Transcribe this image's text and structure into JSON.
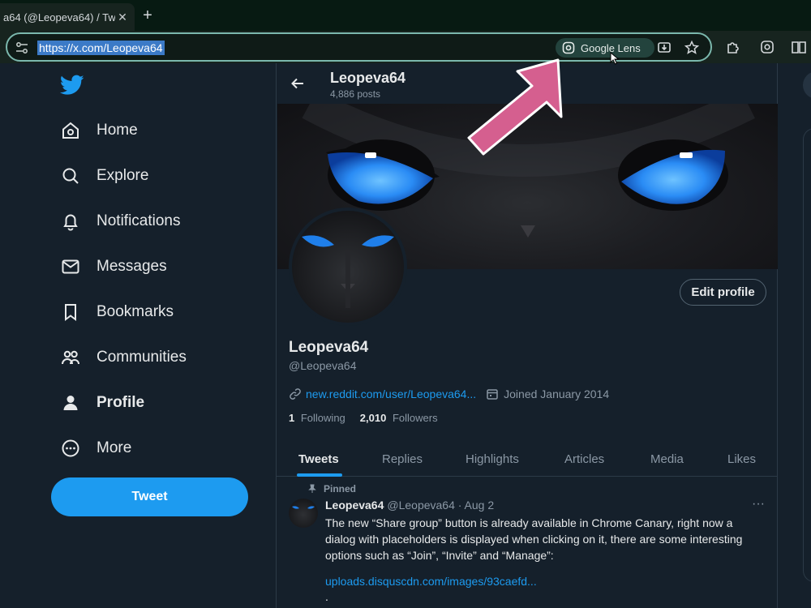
{
  "browser": {
    "tab_title": "a64 (@Leopeva64) / Tw",
    "url": "https://x.com/Leopeva64",
    "lens_label": "Google Lens",
    "accent": "#7bb8ad"
  },
  "nav": {
    "items": [
      {
        "label": "Home",
        "icon": "home-icon"
      },
      {
        "label": "Explore",
        "icon": "search-icon"
      },
      {
        "label": "Notifications",
        "icon": "bell-icon"
      },
      {
        "label": "Messages",
        "icon": "envelope-icon"
      },
      {
        "label": "Bookmarks",
        "icon": "bookmark-icon"
      },
      {
        "label": "Communities",
        "icon": "people-icon"
      },
      {
        "label": "Profile",
        "icon": "person-icon"
      },
      {
        "label": "More",
        "icon": "more-circle-icon"
      }
    ],
    "tweet_label": "Tweet",
    "brand_color": "#1d9bf0"
  },
  "profile": {
    "header_name": "Leopeva64",
    "posts": "4,886 posts",
    "edit_label": "Edit profile",
    "name": "Leopeva64",
    "handle": "@Leopeva64",
    "link": "new.reddit.com/user/Leopeva64...",
    "joined": "Joined January 2014",
    "following_count": "1",
    "following_label": "Following",
    "followers_count": "2,010",
    "followers_label": "Followers"
  },
  "tabs": [
    "Tweets",
    "Replies",
    "Highlights",
    "Articles",
    "Media",
    "Likes"
  ],
  "tweet": {
    "pinned_label": "Pinned",
    "name": "Leopeva64",
    "handle_date": "@Leopeva64 · Aug 2",
    "text": "The new “Share group” button is already available in Chrome Canary, right now a dialog with placeholders is displayed when clicking on it, there are some interesting options such as “Join”, “Invite” and “Manage”:",
    "link": "uploads.disquscdn.com/images/93caefd...",
    "trailing": "."
  }
}
